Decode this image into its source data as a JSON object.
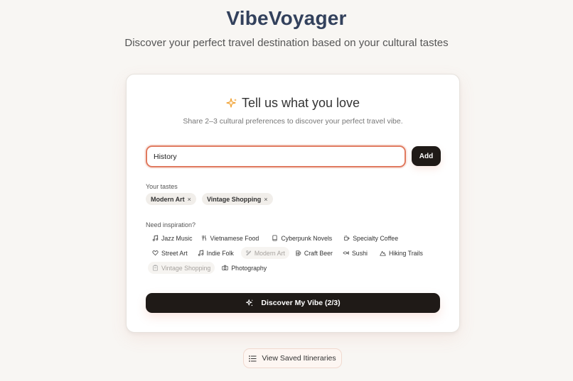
{
  "app": {
    "title": "VibeVoyager",
    "subtitle": "Discover your perfect travel destination based on your cultural tastes"
  },
  "card": {
    "heading": "Tell us what you love",
    "description": "Share 2–3 cultural preferences to discover your perfect travel vibe.",
    "input_value": "History",
    "add_label": "Add",
    "tastes_label": "Your tastes",
    "tastes": [
      {
        "label": "Modern Art",
        "remove": "×"
      },
      {
        "label": "Vintage Shopping",
        "remove": "×"
      }
    ],
    "inspiration_label": "Need inspiration?",
    "inspiration": [
      {
        "label": "Jazz Music",
        "icon": "music-note-icon",
        "disabled": false
      },
      {
        "label": "Vietnamese Food",
        "icon": "utensils-icon",
        "disabled": false
      },
      {
        "label": "Cyberpunk Novels",
        "icon": "book-icon",
        "disabled": false
      },
      {
        "label": "Specialty Coffee",
        "icon": "coffee-icon",
        "disabled": false
      },
      {
        "label": "Street Art",
        "icon": "heart-icon",
        "disabled": false
      },
      {
        "label": "Indie Folk",
        "icon": "music-note-icon",
        "disabled": false
      },
      {
        "label": "Modern Art",
        "icon": "palette-icon",
        "disabled": true
      },
      {
        "label": "Craft Beer",
        "icon": "beer-icon",
        "disabled": false
      },
      {
        "label": "Sushi",
        "icon": "fish-icon",
        "disabled": false
      },
      {
        "label": "Hiking Trails",
        "icon": "mountain-icon",
        "disabled": false
      },
      {
        "label": "Vintage Shopping",
        "icon": "shopping-icon",
        "disabled": true
      },
      {
        "label": "Photography",
        "icon": "camera-icon",
        "disabled": false
      }
    ],
    "discover_label": "Discover My Vibe (2/3)"
  },
  "saved": {
    "label": "View Saved Itineraries"
  },
  "colors": {
    "accent": "#e07a5f",
    "dark": "#1f1a17",
    "title": "#33415c",
    "sparkle": "#f0a030"
  }
}
